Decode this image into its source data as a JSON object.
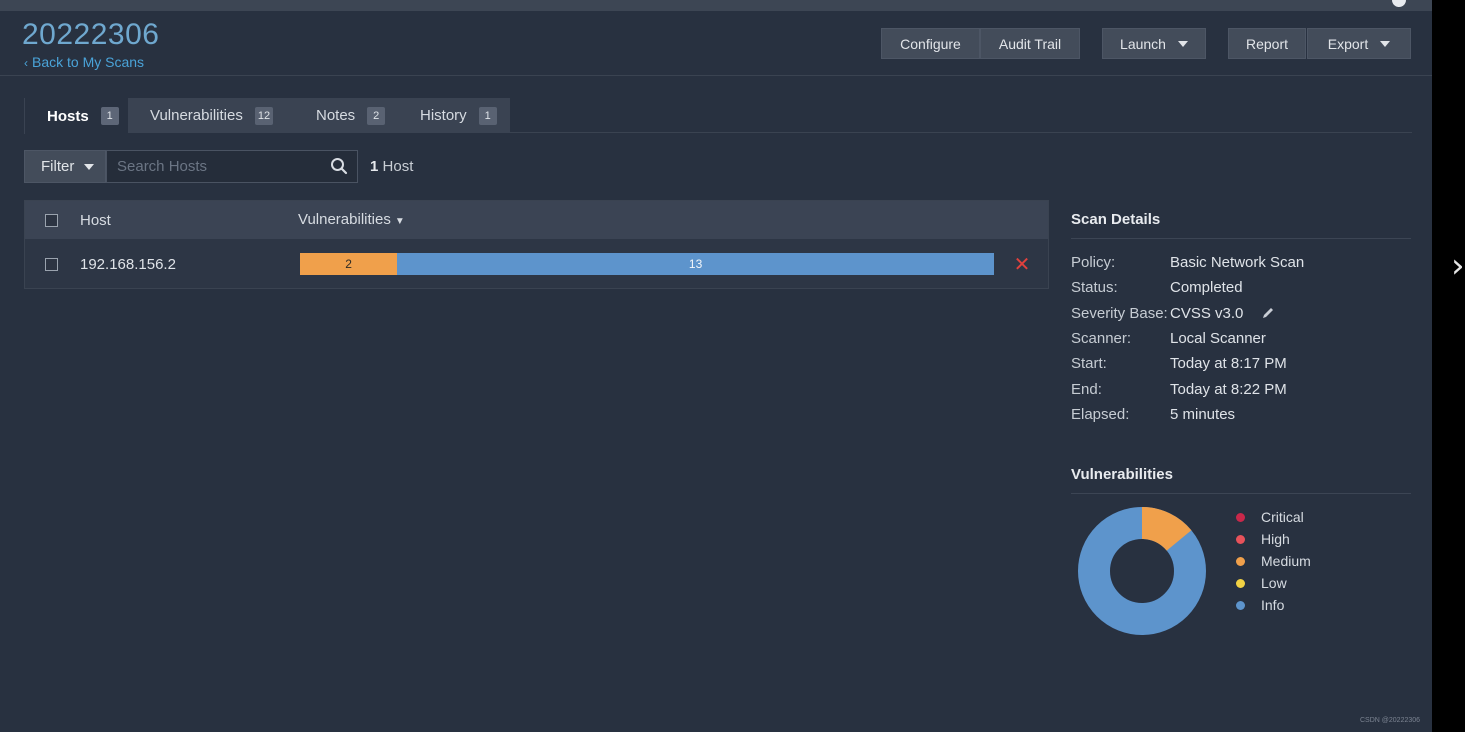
{
  "header": {
    "title": "20222306",
    "back_link": "Back to My Scans",
    "buttons": {
      "configure": "Configure",
      "audit_trail": "Audit Trail",
      "launch": "Launch",
      "report": "Report",
      "export": "Export"
    }
  },
  "tabs": [
    {
      "label": "Hosts",
      "count": "1"
    },
    {
      "label": "Vulnerabilities",
      "count": "12"
    },
    {
      "label": "Notes",
      "count": "2"
    },
    {
      "label": "History",
      "count": "1"
    }
  ],
  "toolbar": {
    "filter_label": "Filter",
    "search_placeholder": "Search Hosts",
    "host_count_number": "1",
    "host_count_label": "Host"
  },
  "table": {
    "columns": {
      "host": "Host",
      "vulnerabilities": "Vulnerabilities"
    },
    "rows": [
      {
        "host": "192.168.156.2",
        "medium": "2",
        "info": "13",
        "medium_fraction": 0.14,
        "info_fraction": 0.86
      }
    ]
  },
  "scan_details": {
    "title": "Scan Details",
    "rows": [
      {
        "key": "Policy:",
        "value": "Basic Network Scan"
      },
      {
        "key": "Status:",
        "value": "Completed"
      },
      {
        "key": "Severity Base:",
        "value": "CVSS v3.0"
      },
      {
        "key": "Scanner:",
        "value": "Local Scanner"
      },
      {
        "key": "Start:",
        "value": "Today at 8:17 PM"
      },
      {
        "key": "End:",
        "value": "Today at 8:22 PM"
      },
      {
        "key": "Elapsed:",
        "value": "5 minutes"
      }
    ]
  },
  "vulnerabilities_panel": {
    "title": "Vulnerabilities",
    "legend": [
      {
        "label": "Critical",
        "color": "#c9284a"
      },
      {
        "label": "High",
        "color": "#e8525a"
      },
      {
        "label": "Medium",
        "color": "#f0a04b"
      },
      {
        "label": "Low",
        "color": "#f2d244"
      },
      {
        "label": "Info",
        "color": "#5d94cc"
      }
    ],
    "donut_fractions": {
      "medium": 0.14,
      "info": 0.86
    }
  },
  "colors": {
    "medium": "#f0a04b",
    "info": "#5d94cc",
    "accent": "#4aa3d8"
  },
  "watermark": "CSDN @20222306"
}
